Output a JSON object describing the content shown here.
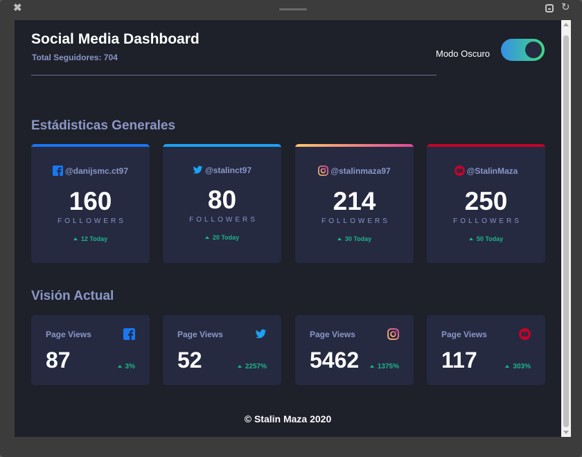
{
  "header": {
    "title": "Social Media Dashboard",
    "total_followers": "Total Seguidores: 704",
    "dark_mode_label": "Modo Oscuro",
    "dark_mode_on": true
  },
  "sections": {
    "general": "Estádisticas Generales",
    "overview": "Visión Actual"
  },
  "cards": [
    {
      "network": "facebook",
      "handle": "@danijsmc.ct97",
      "count": "160",
      "label": "FOLLOWERS",
      "today": "12 Today",
      "color": "#1877f2"
    },
    {
      "network": "twitter",
      "handle": "@stalinct97",
      "count": "80",
      "label": "FOLLOWERS",
      "today": "20 Today",
      "color": "#1da1f2"
    },
    {
      "network": "instagram",
      "handle": "@stalinmaza97",
      "count": "214",
      "label": "FOLLOWERS",
      "today": "30 Today",
      "color": "#df4996"
    },
    {
      "network": "youtube",
      "handle": "@StalinMaza",
      "count": "250",
      "label": "FOLLOWERS",
      "today": "50 Today",
      "color": "#c4032a"
    }
  ],
  "overview": [
    {
      "network": "facebook",
      "label": "Page Views",
      "value": "87",
      "pct": "3%"
    },
    {
      "network": "twitter",
      "label": "Page Views",
      "value": "52",
      "pct": "2257%"
    },
    {
      "network": "instagram",
      "label": "Page Views",
      "value": "5462",
      "pct": "1375%"
    },
    {
      "network": "youtube",
      "label": "Page Views",
      "value": "117",
      "pct": "303%"
    }
  ],
  "footer": "© Stalin Maza 2020",
  "colors": {
    "background": "#1e202a",
    "card": "#252a41",
    "text_muted": "#8b97c6",
    "positive": "#1db489"
  }
}
